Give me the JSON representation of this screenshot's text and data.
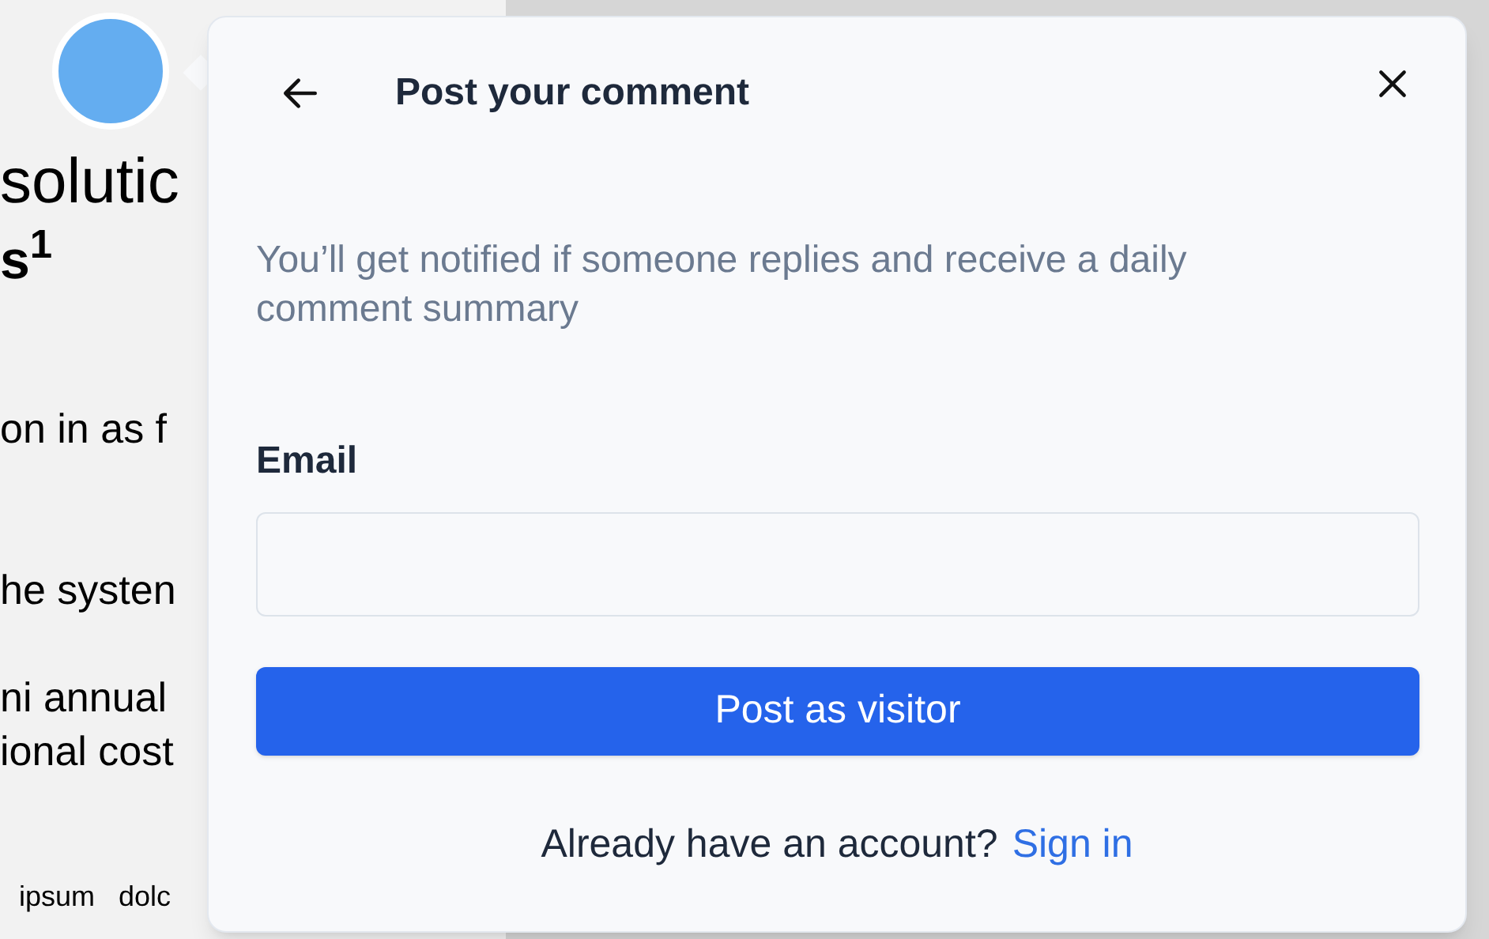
{
  "background_page": {
    "lines": [
      {
        "text": "solutic",
        "kind": "heading"
      },
      {
        "text": "s$^{1}$",
        "kind": "subheading"
      },
      {
        "text": "on in as f",
        "kind": "body"
      },
      {
        "text": "he systen",
        "kind": "body"
      },
      {
        "text": "ni annual",
        "kind": "body"
      },
      {
        "text": "ional cost",
        "kind": "body"
      },
      {
        "text": "ipsum   dolc",
        "kind": "small"
      }
    ]
  },
  "dialog": {
    "title": "Post your comment",
    "description": "You’ll get notified if someone replies and receive a daily comment summary",
    "email": {
      "label": "Email"
    },
    "submit_button": "Post as visitor",
    "footer": {
      "text": "Already have an account?",
      "link": "Sign in"
    }
  }
}
